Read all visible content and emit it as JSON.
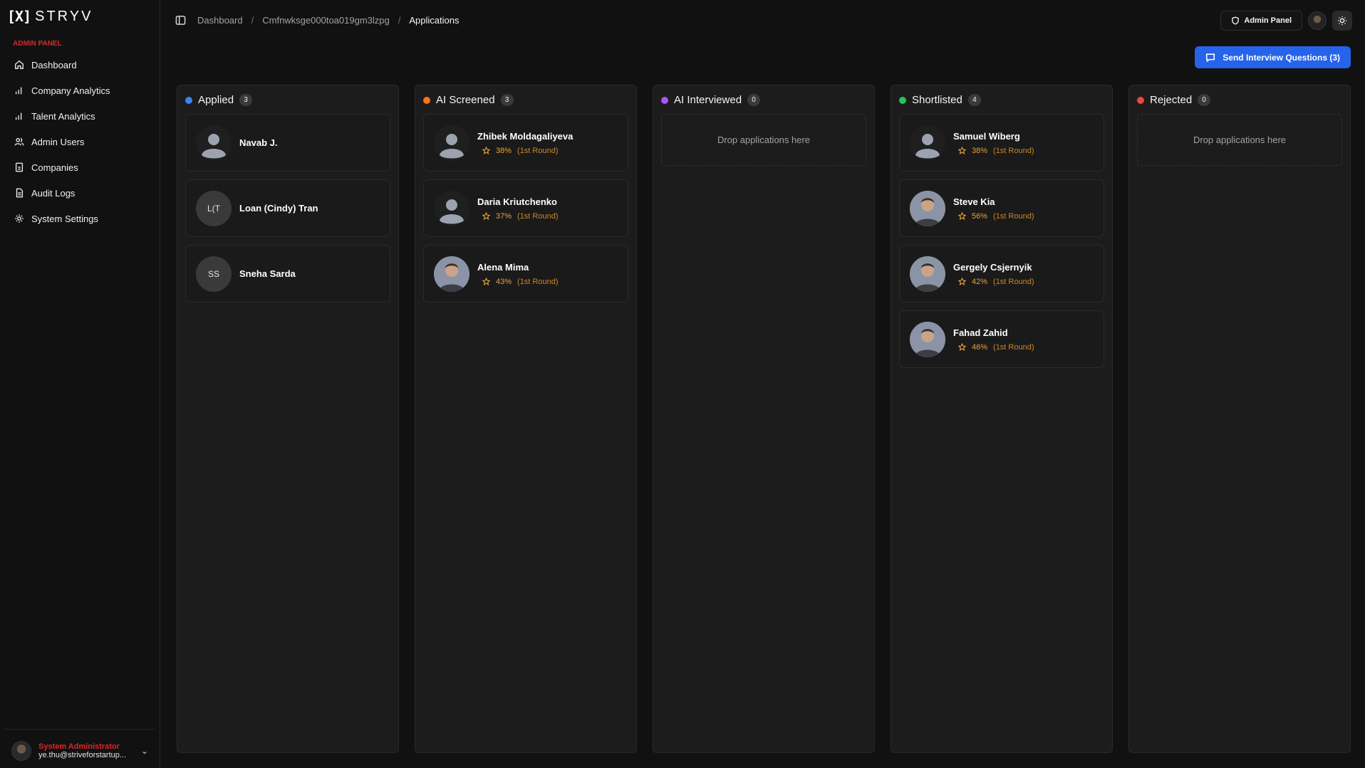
{
  "brand": {
    "mark": "[X]",
    "word": "STRYV"
  },
  "sidebar": {
    "section_label": "ADMIN PANEL",
    "items": [
      {
        "label": "Dashboard",
        "icon": "home-icon"
      },
      {
        "label": "Company Analytics",
        "icon": "bar-chart-icon"
      },
      {
        "label": "Talent Analytics",
        "icon": "bar-chart-icon"
      },
      {
        "label": "Admin Users",
        "icon": "users-icon"
      },
      {
        "label": "Companies",
        "icon": "building-icon"
      },
      {
        "label": "Audit Logs",
        "icon": "file-icon"
      },
      {
        "label": "System Settings",
        "icon": "gear-icon"
      }
    ],
    "user": {
      "role": "System Administrator",
      "email": "ye.thu@striveforstartup..."
    }
  },
  "breadcrumb": {
    "items": [
      "Dashboard",
      "Cmfnwksge000toa019gm3lzpg"
    ],
    "current": "Applications"
  },
  "topbar": {
    "admin_panel_label": "Admin Panel"
  },
  "actions": {
    "send_questions_label": "Send Interview Questions (3)"
  },
  "columns": [
    {
      "title": "Applied",
      "count": "3",
      "color": "#3b82f6",
      "drop_text": "",
      "cards": [
        {
          "name": "Navab J.",
          "avatar": "placeholder"
        },
        {
          "name": "Loan (Cindy) Tran",
          "avatar": "initials",
          "initials": "L(T"
        },
        {
          "name": "Sneha Sarda",
          "avatar": "initials",
          "initials": "SS"
        }
      ]
    },
    {
      "title": "AI Screened",
      "count": "3",
      "color": "#f97316",
      "drop_text": "",
      "cards": [
        {
          "name": "Zhibek Moldagaliyeva",
          "avatar": "placeholder",
          "score": "38%",
          "round": "(1st Round)"
        },
        {
          "name": "Daria Kriutchenko",
          "avatar": "placeholder",
          "score": "37%",
          "round": "(1st Round)"
        },
        {
          "name": "Alena Mima",
          "avatar": "photo",
          "score": "43%",
          "round": "(1st Round)"
        }
      ]
    },
    {
      "title": "AI Interviewed",
      "count": "0",
      "color": "#a855f7",
      "drop_text": "Drop applications here",
      "cards": []
    },
    {
      "title": "Shortlisted",
      "count": "4",
      "color": "#22c55e",
      "drop_text": "",
      "cards": [
        {
          "name": "Samuel Wiberg",
          "avatar": "placeholder",
          "score": "38%",
          "round": "(1st Round)"
        },
        {
          "name": "Steve Kia",
          "avatar": "photo",
          "score": "56%",
          "round": "(1st Round)"
        },
        {
          "name": "Gergely Csjernyik",
          "avatar": "photo",
          "score": "42%",
          "round": "(1st Round)"
        },
        {
          "name": "Fahad Zahid",
          "avatar": "photo",
          "score": "46%",
          "round": "(1st Round)"
        }
      ]
    },
    {
      "title": "Rejected",
      "count": "0",
      "color": "#ef4444",
      "drop_text": "Drop applications here",
      "cards": []
    }
  ]
}
